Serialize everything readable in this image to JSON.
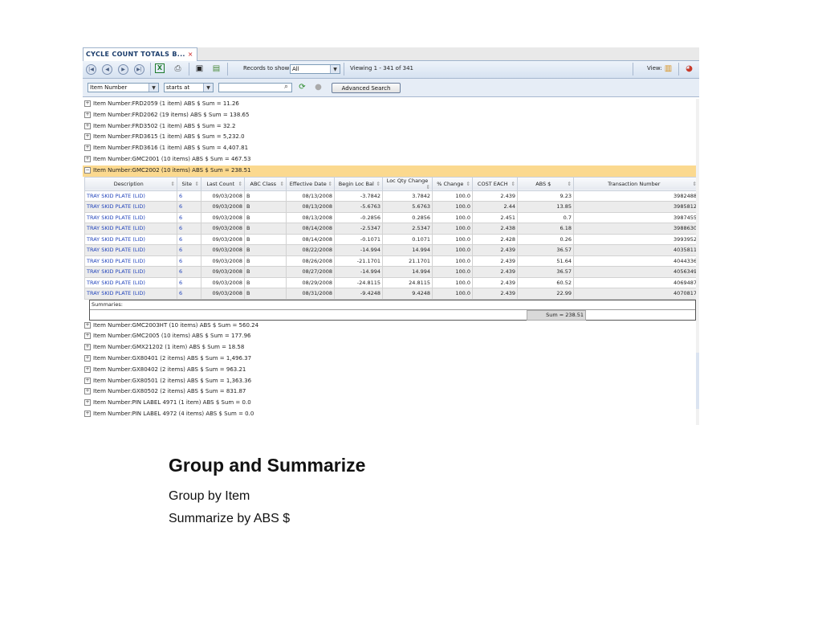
{
  "tab": {
    "label": "CYCLE COUNT TOTALS B...",
    "close": "×"
  },
  "toolbar": {
    "records_label": "Records to show",
    "records_value": "All",
    "viewing": "Viewing  1 - 341  of  341",
    "view_label": "View:"
  },
  "filter": {
    "field": "Item Number",
    "operator": "starts at",
    "search_value": "",
    "advanced_label": "Advanced Search"
  },
  "groups_before": [
    "Item Number:FRD2059 (1 item) ABS $ Sum = 11.26",
    "Item Number:FRD2062 (19 items) ABS $ Sum = 138.65",
    "Item Number:FRD3502 (1 item) ABS $ Sum = 32.2",
    "Item Number:FRD3615 (1 item) ABS $ Sum = 5,232.0",
    "Item Number:FRD3616 (1 item) ABS $ Sum = 4,407.81",
    "Item Number:GMC2001 (10 items) ABS $ Sum = 467.53"
  ],
  "open_group": "Item Number:GMC2002 (10 items) ABS $ Sum = 238.51",
  "columns": [
    "Description",
    "Site",
    "Last Count",
    "ABC Class",
    "Effective Date",
    "Begin Loc Bal",
    "Loc Qty Change",
    "% Change",
    "COST EACH",
    "ABS $",
    "Transaction Number"
  ],
  "rows": [
    [
      "TRAY SKID PLATE (LID)",
      "6",
      "09/03/2008",
      "B",
      "08/13/2008",
      "-3.7842",
      "3.7842",
      "100.0",
      "2.439",
      "9.23",
      "3982488"
    ],
    [
      "TRAY SKID PLATE (LID)",
      "6",
      "09/03/2008",
      "B",
      "08/13/2008",
      "-5.6763",
      "5.6763",
      "100.0",
      "2.44",
      "13.85",
      "3985812"
    ],
    [
      "TRAY SKID PLATE (LID)",
      "6",
      "09/03/2008",
      "B",
      "08/13/2008",
      "-0.2856",
      "0.2856",
      "100.0",
      "2.451",
      "0.7",
      "3987455"
    ],
    [
      "TRAY SKID PLATE (LID)",
      "6",
      "09/03/2008",
      "B",
      "08/14/2008",
      "-2.5347",
      "2.5347",
      "100.0",
      "2.438",
      "6.18",
      "3988630"
    ],
    [
      "TRAY SKID PLATE (LID)",
      "6",
      "09/03/2008",
      "B",
      "08/14/2008",
      "-0.1071",
      "0.1071",
      "100.0",
      "2.428",
      "0.26",
      "3993952"
    ],
    [
      "TRAY SKID PLATE (LID)",
      "6",
      "09/03/2008",
      "B",
      "08/22/2008",
      "-14.994",
      "14.994",
      "100.0",
      "2.439",
      "36.57",
      "4035811"
    ],
    [
      "TRAY SKID PLATE (LID)",
      "6",
      "09/03/2008",
      "B",
      "08/26/2008",
      "-21.1701",
      "21.1701",
      "100.0",
      "2.439",
      "51.64",
      "4044336"
    ],
    [
      "TRAY SKID PLATE (LID)",
      "6",
      "09/03/2008",
      "B",
      "08/27/2008",
      "-14.994",
      "14.994",
      "100.0",
      "2.439",
      "36.57",
      "4056349"
    ],
    [
      "TRAY SKID PLATE (LID)",
      "6",
      "09/03/2008",
      "B",
      "08/29/2008",
      "-24.8115",
      "24.8115",
      "100.0",
      "2.439",
      "60.52",
      "4069487"
    ],
    [
      "TRAY SKID PLATE (LID)",
      "6",
      "09/03/2008",
      "B",
      "08/31/2008",
      "-9.4248",
      "9.4248",
      "100.0",
      "2.439",
      "22.99",
      "4070817"
    ]
  ],
  "summaries_label": "Summaries:",
  "summary_value": "Sum = 238.51",
  "groups_after": [
    "Item Number:GMC2003HT (10 items) ABS $ Sum = 560.24",
    "Item Number:GMC2005 (10 items) ABS $ Sum = 177.96",
    "Item Number:GMX21202 (1 item) ABS $ Sum = 18.58",
    "Item Number:GX80401 (2 items) ABS $ Sum = 1,496.37",
    "Item Number:GX80402 (2 items) ABS $ Sum = 963.21",
    "Item Number:GX80501 (2 items) ABS $ Sum = 1,363.36",
    "Item Number:GX80502 (2 items) ABS $ Sum = 831.87",
    "Item Number:PIN LABEL 4971 (1 item) ABS $ Sum = 0.0",
    "Item Number:PIN LABEL 4972 (4 items) ABS $ Sum = 0.0"
  ],
  "slide": {
    "title": "Group  and Summarize",
    "line1": "Group by Item",
    "line2": "Summarize by ABS $"
  }
}
